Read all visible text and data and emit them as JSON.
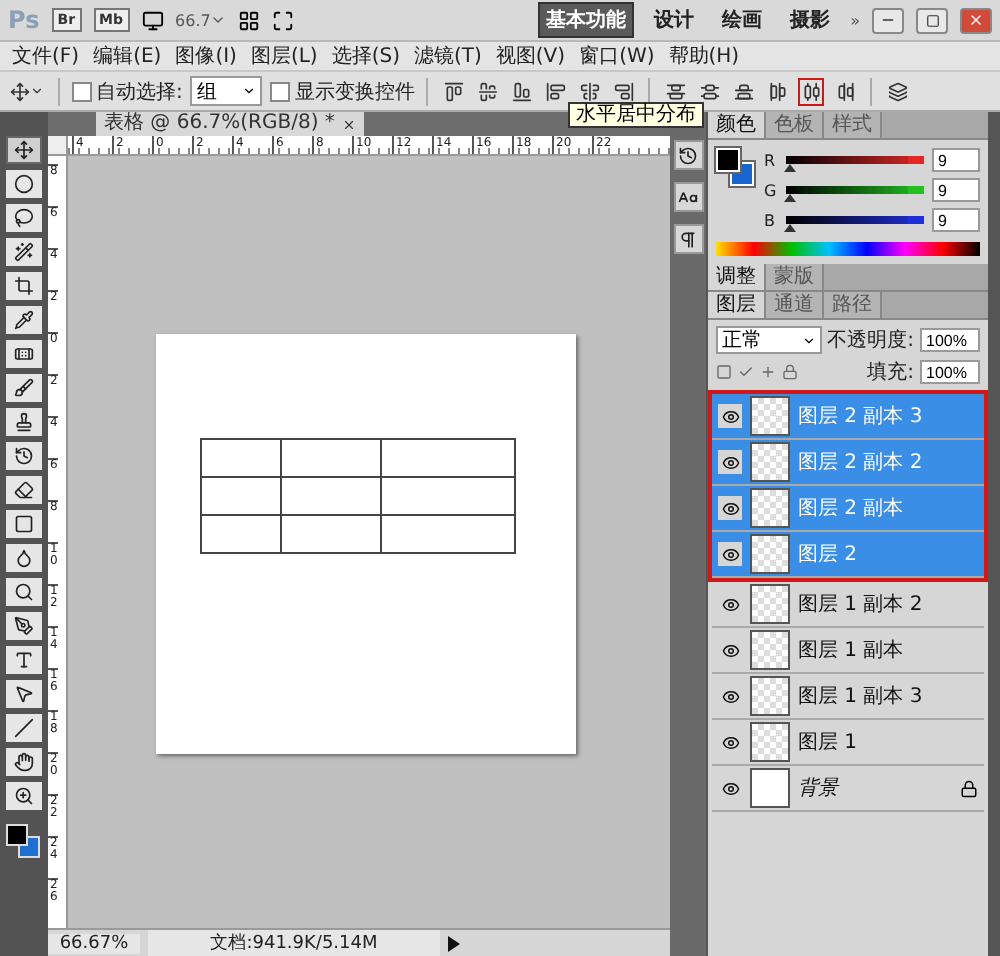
{
  "app_bar": {
    "logo": "Ps",
    "bridge": "Br",
    "mini_bridge": "Mb",
    "zoom": "66.7",
    "workspaces": [
      {
        "label": "基本功能",
        "selected": true
      },
      {
        "label": "设计",
        "selected": false
      },
      {
        "label": "绘画",
        "selected": false
      },
      {
        "label": "摄影",
        "selected": false
      }
    ],
    "more": "»"
  },
  "menu": [
    "文件(F)",
    "编辑(E)",
    "图像(I)",
    "图层(L)",
    "选择(S)",
    "滤镜(T)",
    "视图(V)",
    "窗口(W)",
    "帮助(H)"
  ],
  "options_bar": {
    "auto_select": {
      "label": "自动选择:",
      "checked": false
    },
    "auto_select_target": "组",
    "show_transform": {
      "label": "显示变换控件",
      "checked": false
    },
    "distribute_tools": [
      {
        "framed": false
      },
      {
        "framed": false
      },
      {
        "framed": false
      },
      {
        "framed": false
      },
      {
        "framed": true
      },
      {
        "framed": false
      }
    ],
    "tooltip": "水平居中分布"
  },
  "document": {
    "tab": "表格 @ 66.7%(RGB/8) *",
    "ruler_h": [
      "4",
      "2",
      "0",
      "2",
      "4",
      "6",
      "8",
      "10",
      "12",
      "14",
      "16",
      "18",
      "20",
      "22"
    ],
    "ruler_v": [
      "8",
      "6",
      "4",
      "2",
      "0",
      "2",
      "4",
      "6",
      "8",
      "10",
      "12",
      "14",
      "16",
      "18",
      "20",
      "22",
      "24",
      "26"
    ]
  },
  "status_bar": {
    "zoom": "66.67%",
    "doc_size": "文档:941.9K/5.14M"
  },
  "color_panel": {
    "tabs": [
      {
        "label": "颜色",
        "selected": true
      },
      {
        "label": "色板",
        "selected": false
      },
      {
        "label": "样式",
        "selected": false
      }
    ],
    "channels": [
      {
        "label": "R",
        "value": "9",
        "level": 0.035,
        "color": "#e02828"
      },
      {
        "label": "G",
        "value": "9",
        "level": 0.035,
        "color": "#22c022"
      },
      {
        "label": "B",
        "value": "9",
        "level": 0.035,
        "color": "#2030d8"
      }
    ]
  },
  "adjust_tabs": [
    {
      "label": "调整",
      "selected": true
    },
    {
      "label": "蒙版",
      "selected": false
    }
  ],
  "layers_panel": {
    "tabs": [
      {
        "label": "图层",
        "selected": true
      },
      {
        "label": "通道",
        "selected": false
      },
      {
        "label": "路径",
        "selected": false
      }
    ],
    "blend_mode": "正常",
    "opacity_label": "不透明度:",
    "opacity": "100%",
    "fill_label": "填充:",
    "fill": "100%",
    "groups": [
      {
        "framed": true,
        "layers": [
          {
            "name": "图层 2 副本 3",
            "kind": "layer",
            "selected": true
          },
          {
            "name": "图层 2 副本 2",
            "kind": "layer",
            "selected": true
          },
          {
            "name": "图层 2 副本",
            "kind": "layer",
            "selected": true
          },
          {
            "name": "图层 2",
            "kind": "layer",
            "selected": true
          }
        ]
      },
      {
        "framed": false,
        "layers": [
          {
            "name": "图层 1 副本 2",
            "kind": "layer",
            "selected": false
          },
          {
            "name": "图层 1 副本",
            "kind": "layer",
            "selected": false
          },
          {
            "name": "图层 1 副本 3",
            "kind": "layer",
            "selected": false
          },
          {
            "name": "图层 1",
            "kind": "layer",
            "selected": false
          },
          {
            "name": "背景",
            "kind": "background",
            "selected": false
          }
        ]
      }
    ]
  }
}
